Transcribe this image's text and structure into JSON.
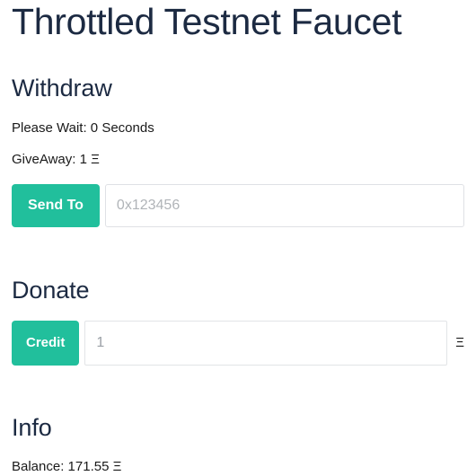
{
  "page": {
    "title": "Throttled Testnet Faucet",
    "eth_symbol": "Ξ"
  },
  "theme": {
    "accent": "#21bf9c",
    "heading_color": "#1c2a42",
    "text_color": "#1a1a1a",
    "input_border": "#dfe1e5",
    "placeholder_color": "#b0b4b8",
    "background": "#ffffff"
  },
  "withdraw": {
    "heading": "Withdraw",
    "wait_line": "Please Wait: 0 Seconds",
    "wait_seconds": "0",
    "giveaway_line": "GiveAway: 1 Ξ",
    "giveaway_amount": "1",
    "send_button": "Send To",
    "address_placeholder": "0x123456",
    "address_value": ""
  },
  "donate": {
    "heading": "Donate",
    "credit_button": "Credit",
    "amount_value": "1",
    "amount_placeholder": "1",
    "unit": "Ξ"
  },
  "info": {
    "heading": "Info",
    "balance_line": "Balance: 171.55 Ξ",
    "balance_amount": "171.55",
    "unit": "Ξ"
  }
}
